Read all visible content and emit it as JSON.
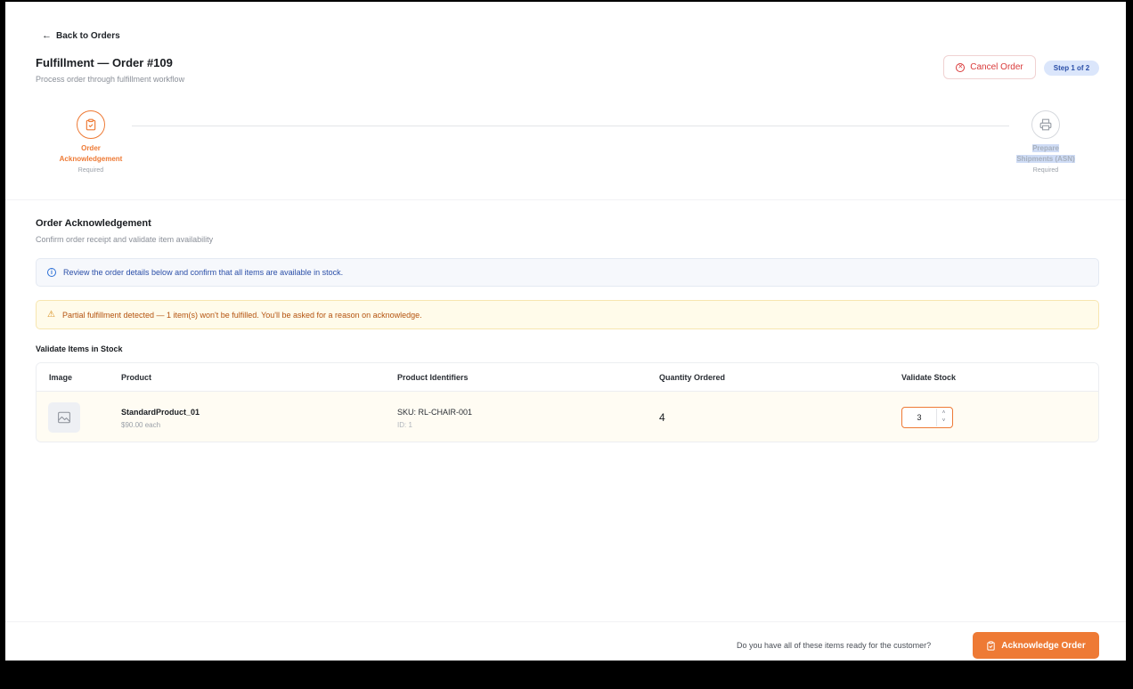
{
  "header": {
    "back_label": "Back to Orders",
    "title": "Fulfillment — Order #109",
    "subtitle": "Process order through fulfillment workflow",
    "cancel_label": "Cancel Order",
    "step_badge": "Step 1 of 2"
  },
  "stepper": {
    "steps": [
      {
        "label_line1": "Order",
        "label_line2": "Acknowledgement",
        "requirement": "Required",
        "icon": "clipboard-check-icon",
        "state": "active"
      },
      {
        "label_line1": "Prepare",
        "label_line2": "Shipments (ASN)",
        "requirement": "Required",
        "icon": "printer-icon",
        "state": "inactive"
      }
    ]
  },
  "section": {
    "title": "Order Acknowledgement",
    "subtitle": "Confirm order receipt and validate item availability",
    "info_message": "Review the order details below and confirm that all items are available in stock.",
    "warning_message": "Partial fulfillment detected — 1 item(s) won't be fulfilled. You'll be asked for a reason on acknowledge."
  },
  "table": {
    "caption": "Validate Items in Stock",
    "columns": [
      "Image",
      "Product",
      "Product Identifiers",
      "Quantity Ordered",
      "Validate Stock"
    ],
    "rows": [
      {
        "product_name": "StandardProduct_01",
        "price": "$90.00 each",
        "sku": "SKU: RL-CHAIR-001",
        "id": "ID: 1",
        "quantity_ordered": "4",
        "validated_stock": "3"
      }
    ]
  },
  "footer": {
    "question": "Do you have all of these items ready for the customer?",
    "acknowledge_label": "Acknowledge Order"
  },
  "colors": {
    "accent": "#ee7a35",
    "danger": "#d93a3a",
    "info": "#2b4fa8",
    "warning": "#b4530f"
  }
}
